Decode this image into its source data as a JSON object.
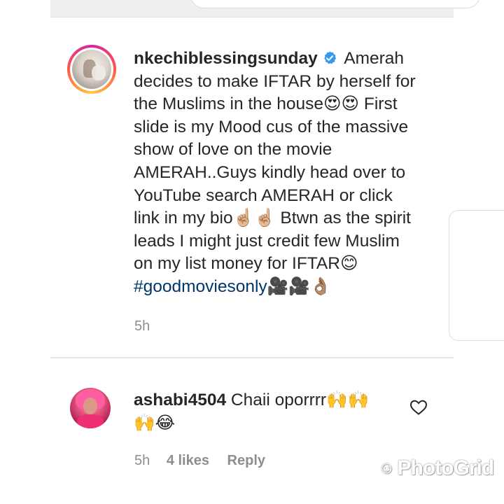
{
  "comment1": {
    "username": "nkechiblessingsunday",
    "lines": [
      " Amerah",
      "decides to make IFTAR by herself for",
      "the Muslims in the house😍😍 First",
      "slide is my Mood cus of the massive",
      "show of love on the movie",
      "AMERAH..Guys kindly head over to",
      "YouTube search AMERAH or click",
      "link in my bio☝🏼☝🏼 Btwn as the spirit",
      "leads I might just credit few Muslim",
      "on my list money for IFTAR😊"
    ],
    "hashtag": "#goodmoviesonly",
    "hashtag_suffix": "🎥🎥👌🏽",
    "time": "5h"
  },
  "comment2": {
    "username": "ashabi4504",
    "text_line1": " Chaii oporrrr🙌🙌",
    "text_line2": "🙌😂",
    "time": "5h",
    "likes": "4 likes",
    "reply": "Reply"
  },
  "watermark": {
    "icon": "☺",
    "text": "PhotoGrid"
  },
  "icons": {
    "verified": "verified-badge-icon",
    "like": "heart-icon"
  },
  "colors": {
    "text": "#262626",
    "meta": "#8e8e8e",
    "hashtag": "#00376b",
    "verified": "#3897f0"
  }
}
